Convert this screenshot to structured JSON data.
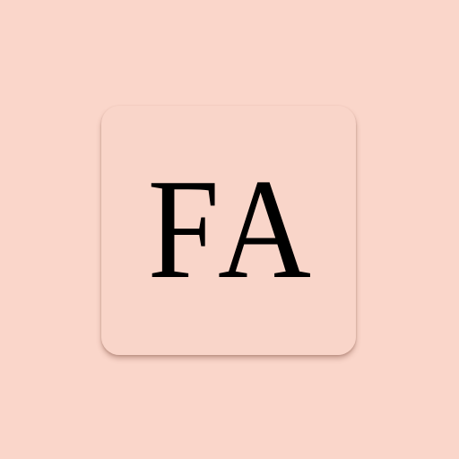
{
  "app_icon": {
    "monogram": "FA"
  },
  "colors": {
    "background": "#FAD6CA",
    "tile": "#F9D5C9",
    "text": "#000000"
  }
}
